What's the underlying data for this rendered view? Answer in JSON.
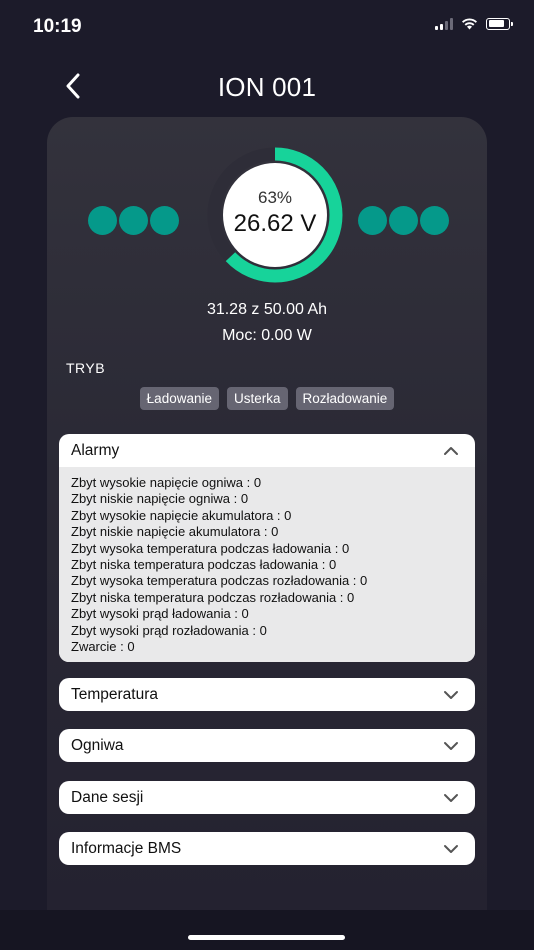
{
  "status_bar": {
    "time": "10:19"
  },
  "nav": {
    "title": "ION 001"
  },
  "battery": {
    "percent_label": "63%",
    "percent_value": 63,
    "voltage": "26.62 V",
    "capacity": "31.28 z 50.00 Ah",
    "power": "Moc: 0.00 W",
    "accent_color": "#17d39a",
    "cell_color": "#05998a"
  },
  "mode": {
    "label": "TRYB",
    "buttons": [
      "Ładowanie",
      "Usterka",
      "Rozładowanie"
    ]
  },
  "sections": {
    "alarms": {
      "title": "Alarmy",
      "expanded": true,
      "rows": [
        "Zbyt wysokie napięcie ogniwa : 0",
        "Zbyt niskie napięcie ogniwa : 0",
        "Zbyt wysokie napięcie akumulatora : 0",
        "Zbyt niskie napięcie akumulatora : 0",
        "Zbyt wysoka temperatura podczas ładowania : 0",
        "Zbyt niska temperatura podczas ładowania : 0",
        "Zbyt wysoka temperatura podczas rozładowania : 0",
        "Zbyt niska temperatura podczas rozładowania : 0",
        "Zbyt wysoki prąd ładowania : 0",
        "Zbyt wysoki prąd rozładowania : 0",
        "Zwarcie : 0"
      ]
    },
    "temperature": {
      "title": "Temperatura"
    },
    "cells": {
      "title": "Ogniwa"
    },
    "session": {
      "title": "Dane sesji"
    },
    "bms": {
      "title": "Informacje BMS"
    }
  }
}
